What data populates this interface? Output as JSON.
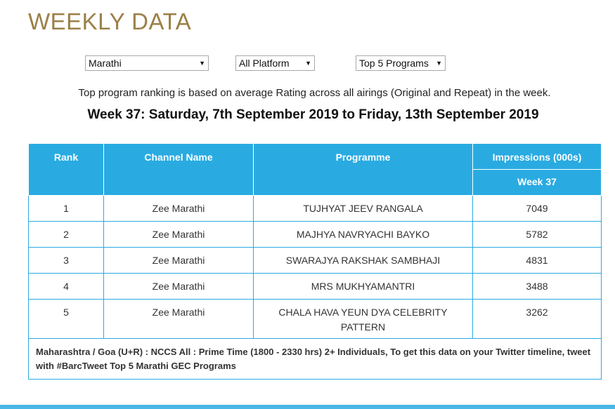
{
  "page": {
    "title": "WEEKLY DATA"
  },
  "filters": {
    "language": "Marathi",
    "platform": "All Platform",
    "programs": "Top 5 Programs"
  },
  "note": "Top program ranking is based on average Rating across all airings (Original and Repeat) in the week.",
  "week_heading": "Week 37: Saturday, 7th September 2019 to Friday, 13th September 2019",
  "table": {
    "headers": {
      "rank": "Rank",
      "channel": "Channel Name",
      "programme": "Programme",
      "impressions": "Impressions (000s)",
      "week": "Week 37"
    },
    "rows": [
      {
        "rank": "1",
        "channel": "Zee Marathi",
        "programme": "TUJHYAT JEEV RANGALA",
        "impressions": "7049"
      },
      {
        "rank": "2",
        "channel": "Zee Marathi",
        "programme": "MAJHYA NAVRYACHI BAYKO",
        "impressions": "5782"
      },
      {
        "rank": "3",
        "channel": "Zee Marathi",
        "programme": "SWARAJYA RAKSHAK SAMBHAJI",
        "impressions": "4831"
      },
      {
        "rank": "4",
        "channel": "Zee Marathi",
        "programme": "MRS MUKHYAMANTRI",
        "impressions": "3488"
      },
      {
        "rank": "5",
        "channel": "Zee Marathi",
        "programme": "CHALA HAVA YEUN DYA CELEBRITY PATTERN",
        "impressions": "3262"
      }
    ],
    "footer": "Maharashtra / Goa (U+R) : NCCS All : Prime Time (1800 - 2330 hrs) 2+ Individuals, To get this data on your Twitter timeline, tweet with #BarcTweet Top 5 Marathi GEC Programs"
  },
  "colors": {
    "accent": "#29abe2",
    "title": "#9b8047"
  },
  "icons": {
    "dropdown": "caret-down-icon"
  }
}
